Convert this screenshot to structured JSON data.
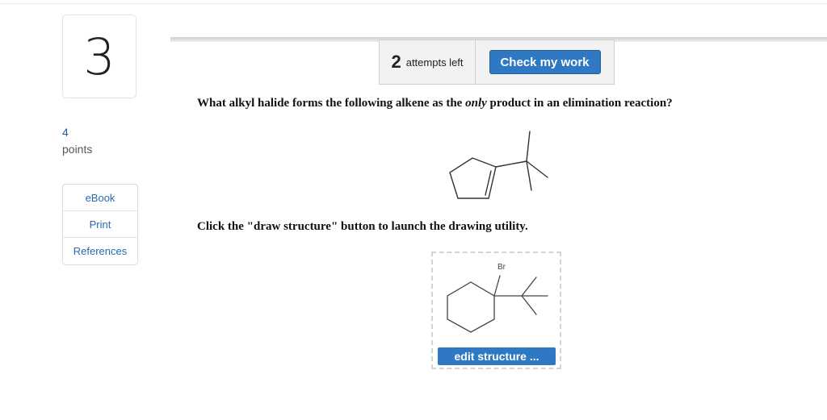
{
  "question": {
    "number": "3",
    "points_value": "4",
    "points_label": "points",
    "text_before": "What alkyl halide forms the following alkene as the ",
    "text_emphasis": "only",
    "text_after": " product in an elimination reaction?",
    "instruction": "Click the \"draw structure\" button to launch the drawing utility."
  },
  "resources": {
    "items": [
      {
        "label": "eBook"
      },
      {
        "label": "Print"
      },
      {
        "label": "References"
      }
    ]
  },
  "attempts": {
    "count": "2",
    "label": "attempts left"
  },
  "check_button": {
    "label": "Check my work"
  },
  "drawing": {
    "atom_label": "Br",
    "edit_button_label": "edit structure ..."
  },
  "colors": {
    "accent_blue": "#2f78c4",
    "link_blue": "#2a6aad"
  }
}
